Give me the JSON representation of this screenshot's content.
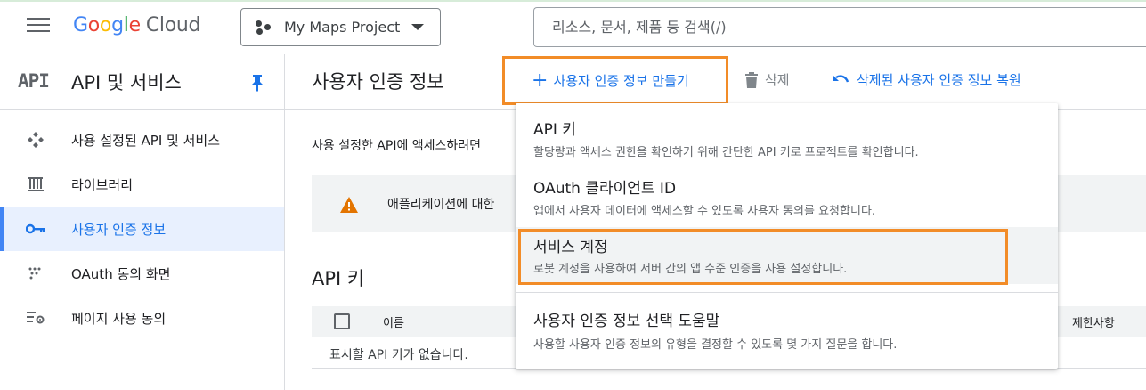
{
  "topbar": {
    "logo": {
      "g1": "G",
      "g2": "o",
      "g3": "o",
      "g4": "g",
      "g5": "l",
      "g6": "e",
      "cloud": "Cloud"
    },
    "project_name": "My Maps Project",
    "search_placeholder": "리소스, 문서, 제품 등 검색(/)"
  },
  "sidebar": {
    "logo_text": "API",
    "title": "API 및 서비스",
    "items": [
      {
        "label": "사용 설정된 API 및 서비스",
        "icon": "api-diamond-icon",
        "active": false
      },
      {
        "label": "라이브러리",
        "icon": "library-icon",
        "active": false
      },
      {
        "label": "사용자 인증 정보",
        "icon": "key-icon",
        "active": true
      },
      {
        "label": "OAuth 동의 화면",
        "icon": "consent-dots-icon",
        "active": false
      },
      {
        "label": "페이지 사용 동의",
        "icon": "settings-list-icon",
        "active": false
      }
    ]
  },
  "main": {
    "title": "사용자 인증 정보",
    "toolbar": {
      "create_label": "사용자 인증 정보 만들기",
      "delete_label": "삭제",
      "restore_label": "삭제된 사용자 인증 정보 복원"
    },
    "description": "사용 설정한 API에 액세스하려면",
    "warning_text": "애플리케이션에 대한",
    "api_keys_title": "API 키",
    "table": {
      "col_name": "이름",
      "col_restrictions": "제한사항",
      "empty_text": "표시할 API 키가 없습니다."
    }
  },
  "menu": {
    "items": [
      {
        "title": "API 키",
        "desc": "할당량과 액세스 권한을 확인하기 위해 간단한 API 키로 프로젝트를 확인합니다."
      },
      {
        "title": "OAuth 클라이언트 ID",
        "desc": "앱에서 사용자 데이터에 액세스할 수 있도록 사용자 동의를 요청합니다."
      },
      {
        "title": "서비스 계정",
        "desc": "로봇 계정을 사용하여 서버 간의 앱 수준 인증을 사용 설정합니다."
      },
      {
        "title": "사용자 인증 정보 선택 도움말",
        "desc": "사용할 사용자 인증 정보의 유형을 결정할 수 있도록 몇 가지 질문을 합니다."
      }
    ]
  },
  "colors": {
    "accent": "#1a73e8",
    "highlight_box": "#f28c28",
    "active_nav_bg": "#e8f0fe"
  }
}
